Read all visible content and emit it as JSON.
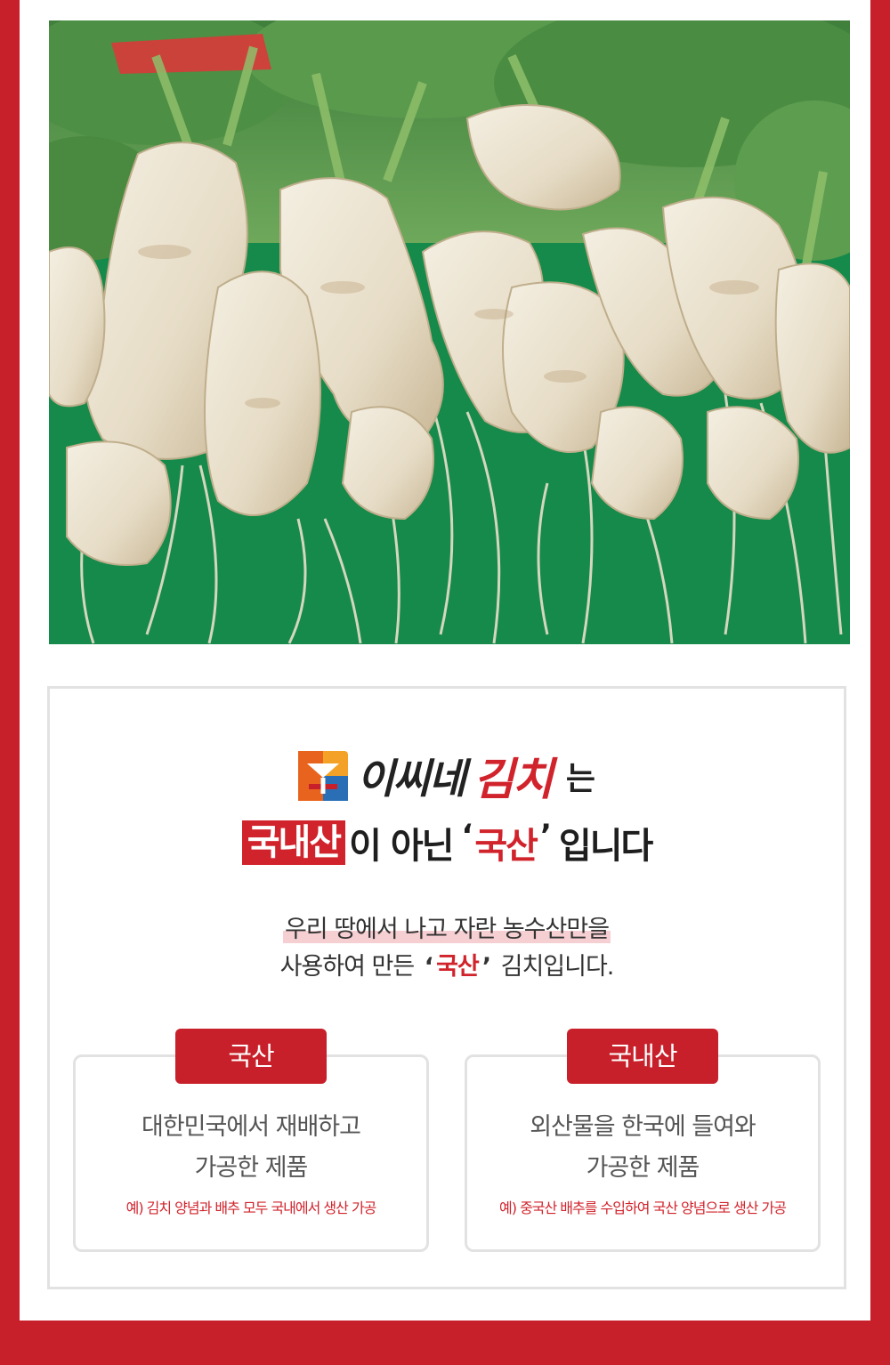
{
  "brand": {
    "name": "이씨네",
    "kimchi": "김치",
    "suffix": "는"
  },
  "headline": {
    "boxed": "국내산",
    "middle": "이 아닌",
    "quote_open": "‘",
    "highlight": "국산",
    "quote_close": "’",
    "end": "입니다"
  },
  "description": {
    "line1": "우리 땅에서 나고 자란 농수산만을",
    "line2_prefix": "사용하여 만든",
    "line2_quote_open": "‘",
    "line2_highlight": "국산",
    "line2_quote_close": "’",
    "line2_suffix": "김치입니다."
  },
  "comparison": [
    {
      "tag": "국산",
      "line1": "대한민국에서 재배하고",
      "line2": "가공한 제품",
      "note": "예) 김치 양념과 배추 모두 국내에서 생산 가공"
    },
    {
      "tag": "국내산",
      "line1": "외산물을 한국에 들여와",
      "line2": "가공한 제품",
      "note": "예) 중국산 배추를 수입하여 국산 양념으로 생산 가공"
    }
  ],
  "colors": {
    "accent": "#c8202a",
    "highlight_pink": "#f6cfd3",
    "photo_background": "#1a8a4c"
  },
  "icons": {
    "photo": "radish-photo",
    "logo": "brand-logo-icon"
  }
}
